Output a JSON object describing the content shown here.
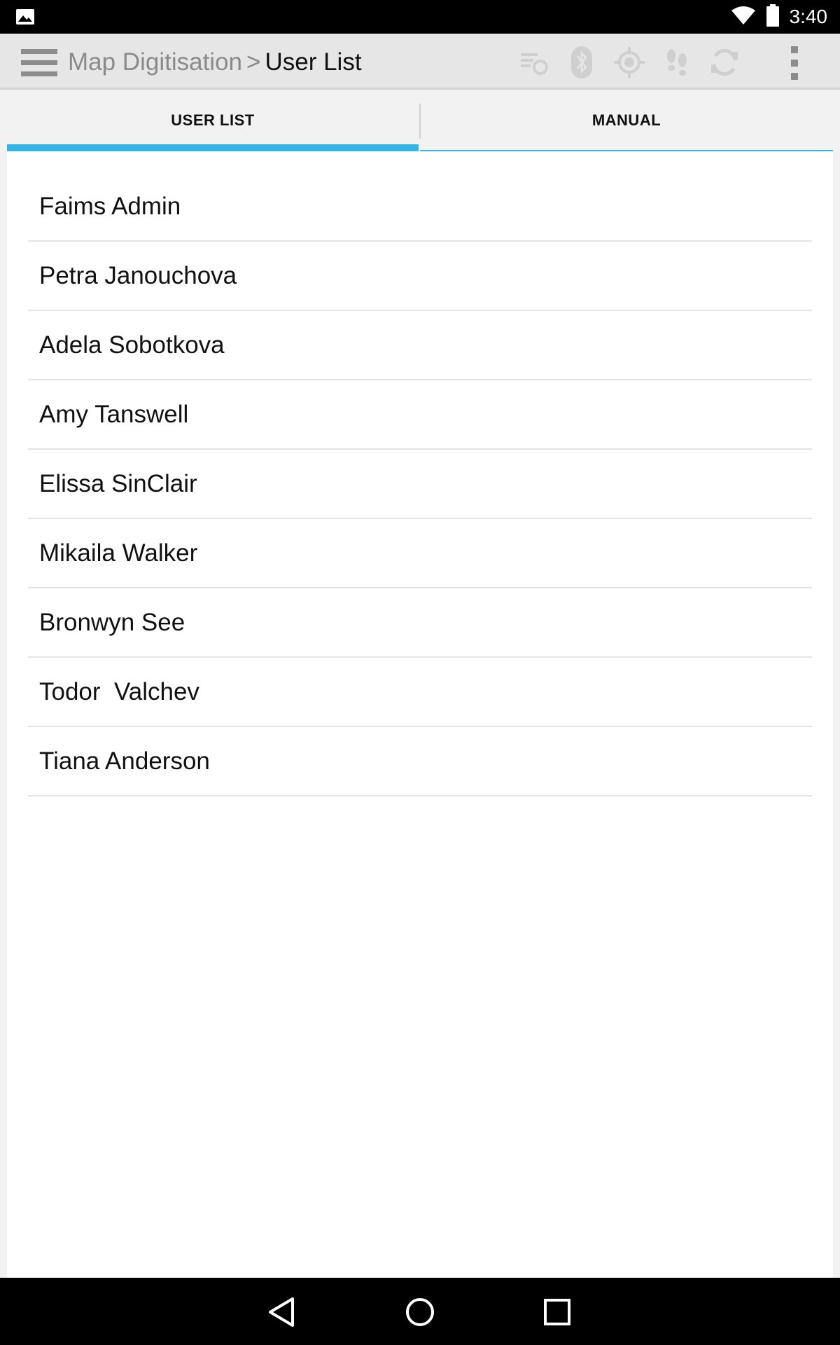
{
  "status_bar": {
    "time": "3:40",
    "icons": [
      "image-notification-icon",
      "wifi-icon",
      "battery-icon"
    ]
  },
  "action_bar": {
    "breadcrumb_parent": "Map Digitisation",
    "separator": ">",
    "current_page": "User List",
    "icons": [
      "sync-list-icon",
      "bluetooth-icon",
      "gps-icon",
      "footsteps-icon",
      "refresh-icon",
      "overflow-menu-icon"
    ]
  },
  "tabs": [
    {
      "label": "USER LIST",
      "active": true
    },
    {
      "label": "MANUAL",
      "active": false
    }
  ],
  "users": [
    "Faims Admin",
    "Petra Janouchova",
    "Adela Sobotkova",
    "Amy Tanswell",
    "Elissa SinClair",
    "Mikaila Walker",
    "Bronwyn See",
    "Todor  Valchev",
    "Tiana Anderson"
  ],
  "colors": {
    "accent": "#33b5e5",
    "action_bar": "#e6e6e6",
    "inactive_icon": "#c8c8c8"
  }
}
